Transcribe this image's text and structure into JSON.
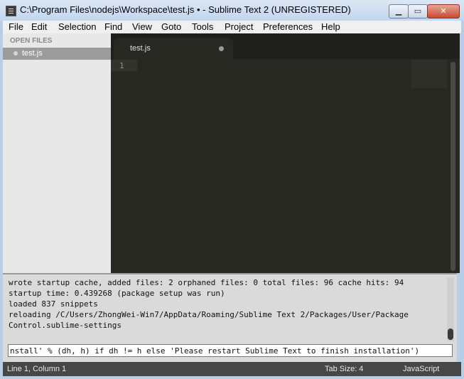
{
  "window": {
    "title": "C:\\Program Files\\nodejs\\Workspace\\test.js • - Sublime Text 2 (UNREGISTERED)",
    "minimize_glyph": "▁",
    "maximize_glyph": "▭",
    "close_glyph": "✕"
  },
  "menu": {
    "items": [
      "File",
      "Edit",
      "Selection",
      "Find",
      "View",
      "Goto",
      "Tools",
      "Project",
      "Preferences",
      "Help"
    ]
  },
  "sidebar": {
    "header": "OPEN FILES",
    "files": [
      {
        "name": "test.js"
      }
    ]
  },
  "editor": {
    "tab_label": "test.js",
    "line_numbers": [
      "1"
    ]
  },
  "console": {
    "lines": [
      "wrote startup cache, added files: 2 orphaned files: 0 total files: 96 cache hits: 94",
      "startup time: 0.439268 (package setup was run)",
      "loaded 837 snippets",
      "reloading /C/Users/ZhongWei-Win7/AppData/Roaming/Sublime Text 2/Packages/User/Package",
      "Control.sublime-settings"
    ],
    "input_value": "nstall' % (dh, h) if dh != h else 'Please restart Sublime Text to finish installation')"
  },
  "status": {
    "position": "Line 1, Column 1",
    "tab_size": "Tab Size: 4",
    "syntax": "JavaScript"
  }
}
